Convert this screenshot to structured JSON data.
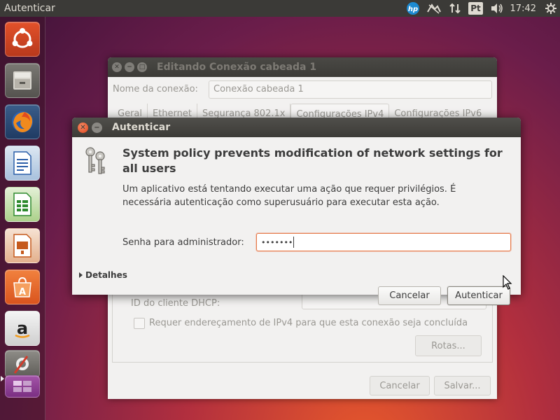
{
  "top_panel": {
    "title": "Autenticar",
    "keyboard_layout": "Pt",
    "clock": "17:42",
    "icons": [
      "hp-icon",
      "network-icon",
      "transfer-icon",
      "keyboard-icon",
      "volume-icon",
      "gear-icon"
    ]
  },
  "launcher": {
    "items": [
      "ubuntu-dash-icon",
      "files-icon",
      "firefox-icon",
      "libreoffice-writer-icon",
      "libreoffice-calc-icon",
      "libreoffice-impress-icon",
      "software-center-icon",
      "amazon-icon",
      "system-settings-icon",
      "workspace-switcher-icon"
    ]
  },
  "back_window": {
    "title": "Editando Conexão cabeada 1",
    "conn_name_label": "Nome da conexão:",
    "conn_name_value": "Conexão cabeada 1",
    "tabs": [
      "Geral",
      "Ethernet",
      "Segurança 802.1x",
      "Configurações IPv4",
      "Configurações IPv6"
    ],
    "dhcp_label": "ID do cliente DHCP:",
    "require_ipv4_label": "Requer endereçamento de IPv4 para que esta conexão seja concluída",
    "routes_button": "Rotas...",
    "cancel_button": "Cancelar",
    "save_button": "Salvar..."
  },
  "auth_dialog": {
    "title": "Autenticar",
    "heading": "System policy prevents modification of network settings for all users",
    "description": "Um aplicativo está tentando executar uma ação que requer privilégios. É necessária autenticação como superusuário para executar esta ação.",
    "password_label": "Senha para administrador:",
    "password_value": "•••••••",
    "details_label": "Detalhes",
    "cancel_button": "Cancelar",
    "authenticate_button": "Autenticar"
  },
  "colors": {
    "panel": "#3b3a37",
    "accent": "#e95420",
    "dialog_bg": "#f2f1f0"
  }
}
